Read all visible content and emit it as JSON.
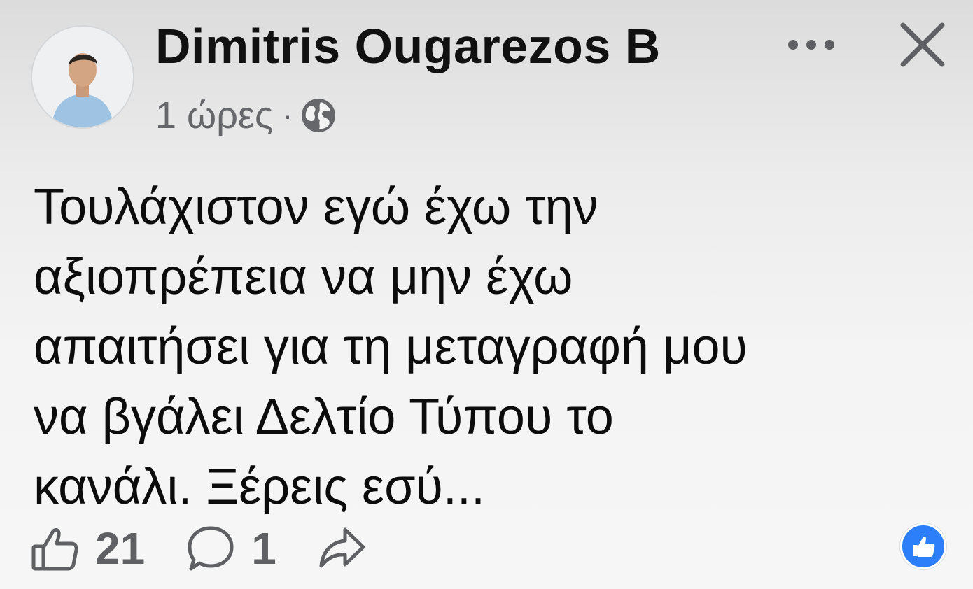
{
  "post": {
    "author": "Dimitris Ougarezos B",
    "time": "1 ώρες",
    "separator": "·",
    "privacy_icon": "globe-icon",
    "text_lines": [
      "Τουλάχιστον εγώ έχω την",
      "αξιοπρέπεια να μην έχω",
      "απαιτήσει για τη μεταγραφή μου",
      "να βγάλει Δελτίο Τύπου το",
      "κανάλι. Ξέρεις εσύ..."
    ]
  },
  "header": {
    "more_icon": "more-dots-icon",
    "close_icon": "close-icon"
  },
  "actions": {
    "like_icon": "thumbs-up-icon",
    "like_count": "21",
    "comment_icon": "comment-bubble-icon",
    "comment_count": "1",
    "share_icon": "share-arrow-icon",
    "reaction_icon": "like-reaction-icon"
  },
  "colors": {
    "text": "#0b0b0b",
    "meta": "#65676b",
    "icon": "#5e6064",
    "reaction_blue": "#2d7ff9"
  }
}
